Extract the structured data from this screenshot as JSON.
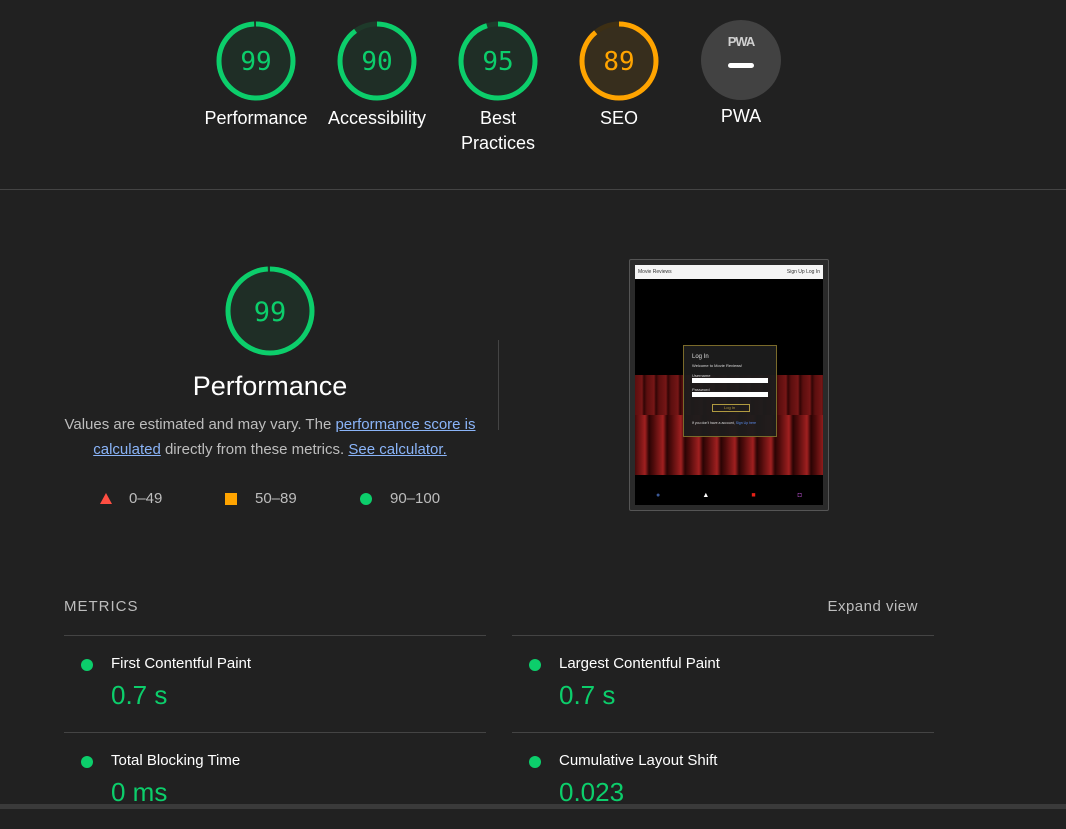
{
  "gauges": [
    {
      "score": "99",
      "label": "Performance",
      "color": "#0cce6b",
      "fraction": 0.99
    },
    {
      "score": "90",
      "label": "Accessibility",
      "color": "#0cce6b",
      "fraction": 0.9
    },
    {
      "score": "95",
      "label_line1": "Best",
      "label_line2": "Practices",
      "color": "#0cce6b",
      "fraction": 0.95
    },
    {
      "score": "89",
      "label": "SEO",
      "color": "#ffa400",
      "fraction": 0.89
    }
  ],
  "pwa": {
    "badge_text": "PWA",
    "label": "PWA"
  },
  "performance": {
    "score": "99",
    "fraction": 0.99,
    "title": "Performance",
    "desc_part1": "Values are estimated and may vary. The ",
    "link1": "performance score is calculated",
    "desc_part2": " directly from these metrics. ",
    "link2": "See calculator."
  },
  "legend": {
    "fail": "0–49",
    "average": "50–89",
    "pass": "90–100"
  },
  "colors": {
    "pass": "#0cce6b",
    "average": "#ffa400",
    "fail": "#ff4e42"
  },
  "thumbnail": {
    "site_name": "Movie Reviews",
    "nav_links": "Sign Up  Log In",
    "login_title": "Log In",
    "login_subtitle": "Welcome to Movie Reviews!",
    "username_label": "Username",
    "password_label": "Password",
    "button_label": "Log In",
    "signup_prompt": "If you don't have a account,",
    "signup_link": "Sign Up here"
  },
  "metrics": {
    "title": "METRICS",
    "expand": "Expand view",
    "items": [
      {
        "name": "First Contentful Paint",
        "value": "0.7 s"
      },
      {
        "name": "Largest Contentful Paint",
        "value": "0.7 s"
      },
      {
        "name": "Total Blocking Time",
        "value": "0 ms"
      },
      {
        "name": "Cumulative Layout Shift",
        "value": "0.023"
      }
    ]
  }
}
